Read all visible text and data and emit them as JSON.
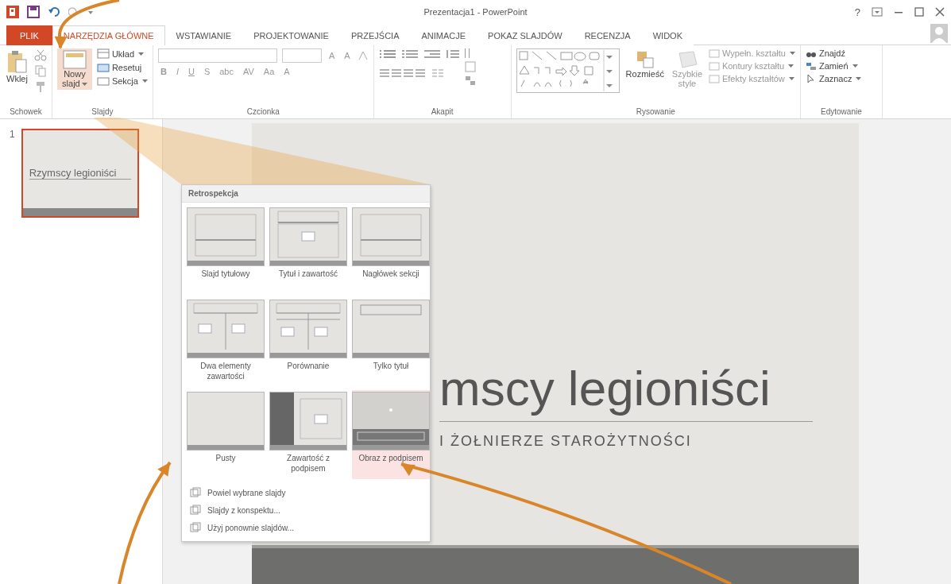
{
  "window": {
    "title": "Prezentacja1 - PowerPoint",
    "help": "?"
  },
  "tabs": [
    {
      "label": "PLIK",
      "kind": "file",
      "selected": false
    },
    {
      "label": "NARZĘDZIA GŁÓWNE",
      "kind": "tab",
      "selected": true
    },
    {
      "label": "WSTAWIANIE",
      "kind": "tab",
      "selected": false
    },
    {
      "label": "PROJEKTOWANIE",
      "kind": "tab",
      "selected": false
    },
    {
      "label": "PRZEJŚCIA",
      "kind": "tab",
      "selected": false
    },
    {
      "label": "ANIMACJE",
      "kind": "tab",
      "selected": false
    },
    {
      "label": "POKAZ SLAJDÓW",
      "kind": "tab",
      "selected": false
    },
    {
      "label": "RECENZJA",
      "kind": "tab",
      "selected": false
    },
    {
      "label": "WIDOK",
      "kind": "tab",
      "selected": false
    }
  ],
  "ribbon": {
    "clipboard": {
      "label": "Schowek",
      "paste": "Wklej"
    },
    "slides": {
      "label": "Slajdy",
      "new_slide": "Nowy slajd",
      "layout": "Układ",
      "reset": "Resetuj",
      "section": "Sekcja"
    },
    "font": {
      "label": "Czcionka",
      "size_buttons": [
        "A",
        "A"
      ],
      "format_buttons": [
        "B",
        "I",
        "U",
        "S",
        "abc",
        "AV",
        "Aa",
        "A"
      ]
    },
    "paragraph": {
      "label": "Akapit"
    },
    "drawing": {
      "label": "Rysowanie",
      "arrange": "Rozmieść",
      "quick_styles": "Szybkie style",
      "commands": [
        "Wypełn. kształtu",
        "Kontury kształtu",
        "Efekty kształtów"
      ]
    },
    "editing": {
      "label": "Edytowanie",
      "commands": [
        "Znajdź",
        "Zamień",
        "Zaznacz"
      ]
    }
  },
  "slides_pane": [
    {
      "number": "1",
      "title": "Rzymscy legioniści",
      "selected": true
    }
  ],
  "slide": {
    "title": "mscy legioniści",
    "subtitle": "I ŻOŁNIERZE STAROŻYTNOŚCI"
  },
  "layout_menu": {
    "heading": "Retrospekcja",
    "layouts": [
      {
        "label": "Slajd tytułowy",
        "kind": "title",
        "selected": false
      },
      {
        "label": "Tytuł i zawartość",
        "kind": "title-content",
        "selected": false
      },
      {
        "label": "Nagłówek sekcji",
        "kind": "section",
        "selected": false
      },
      {
        "label": "Dwa elementy zawartości",
        "kind": "two-content",
        "selected": false
      },
      {
        "label": "Porównanie",
        "kind": "comparison",
        "selected": false
      },
      {
        "label": "Tylko tytuł",
        "kind": "title-only",
        "selected": false
      },
      {
        "label": "Pusty",
        "kind": "blank",
        "selected": false
      },
      {
        "label": "Zawartość z podpisem",
        "kind": "content-caption",
        "selected": false
      },
      {
        "label": "Obraz z podpisem",
        "kind": "picture-caption",
        "selected": true
      }
    ],
    "commands": [
      "Powiel wybrane slajdy",
      "Slajdy z konspektu...",
      "Użyj ponownie slajdów..."
    ]
  }
}
